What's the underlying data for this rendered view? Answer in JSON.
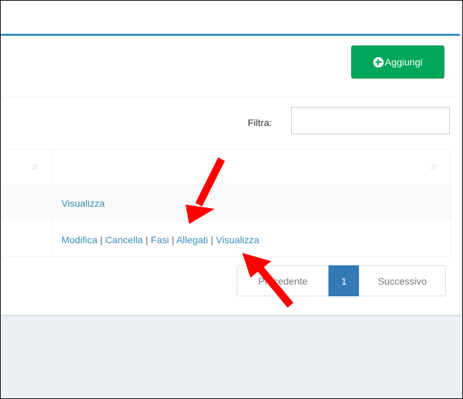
{
  "toolbar": {
    "add_label": "Aggiungi"
  },
  "filter": {
    "label": "Filtra:",
    "value": "",
    "placeholder": ""
  },
  "table": {
    "sort_glyph": "↓↑",
    "rows": [
      {
        "actions": [
          "Visualizza"
        ]
      },
      {
        "actions": [
          "Modifica",
          "Cancella",
          "Fasi",
          "Allegati",
          "Visualizza"
        ]
      }
    ]
  },
  "pager": {
    "prev": "Precedente",
    "page": "1",
    "next": "Successivo"
  },
  "separator": "|",
  "colors": {
    "primary": "#3c8dbc",
    "success": "#00a65a",
    "arrow": "#ff0000"
  }
}
